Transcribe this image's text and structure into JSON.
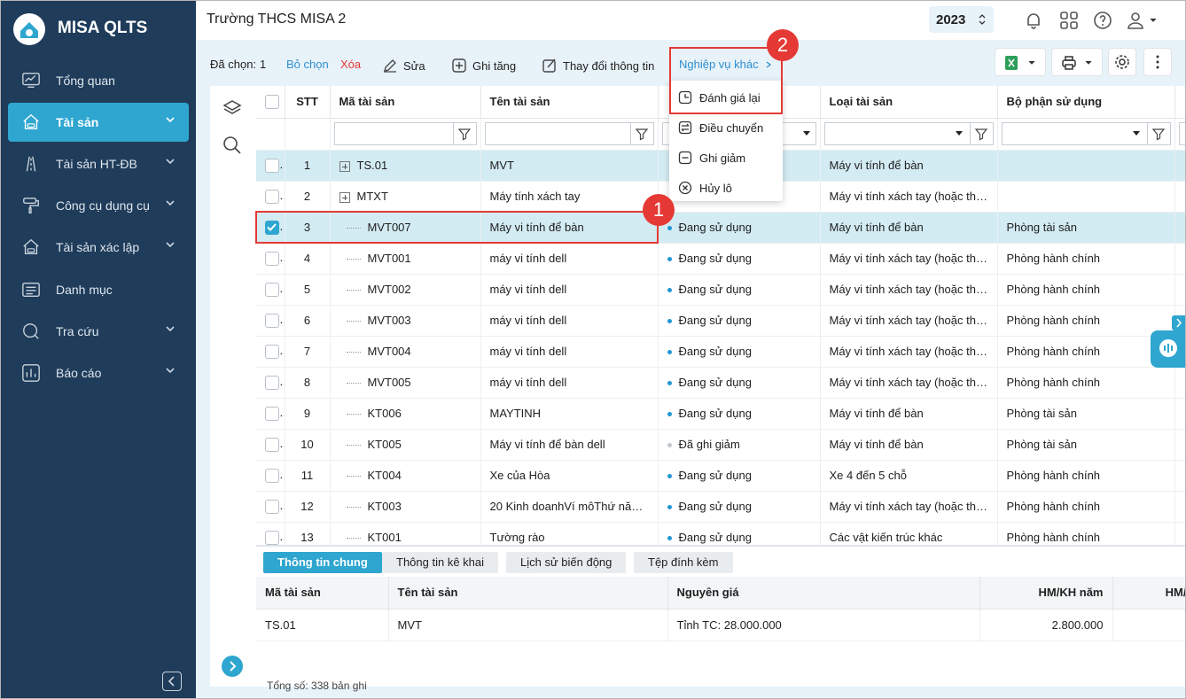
{
  "app": {
    "name": "MISA QLTS"
  },
  "sidebar": {
    "items": [
      {
        "label": "Tổng quan",
        "icon": "monitor-chart-icon"
      },
      {
        "label": "Tài sản",
        "icon": "house-car-icon",
        "active": true
      },
      {
        "label": "Tài sản HT-ĐB",
        "icon": "road-icon"
      },
      {
        "label": "Công cụ dụng cụ",
        "icon": "paint-roller-icon"
      },
      {
        "label": "Tài sản xác lập",
        "icon": "house-car-icon"
      },
      {
        "label": "Danh mục",
        "icon": "list-icon"
      },
      {
        "label": "Tra cứu",
        "icon": "search-icon"
      },
      {
        "label": "Báo cáo",
        "icon": "bar-chart-icon"
      }
    ]
  },
  "header": {
    "unit": "Trường THCS MISA 2",
    "year": "2023"
  },
  "toolbar": {
    "selected_label": "Đã chọn:",
    "selected_count": "1",
    "deselect": "Bỏ chọn",
    "delete": "Xóa",
    "edit": "Sửa",
    "increase": "Ghi tăng",
    "change_info": "Thay đổi thông tin",
    "other": "Nghiệp vụ khác"
  },
  "menu": {
    "items": [
      "Đánh giá lại",
      "Điều chuyển",
      "Ghi giảm",
      "Hủy lô"
    ]
  },
  "grid": {
    "columns": [
      "STT",
      "Mã tài sản",
      "Tên tài sản",
      "",
      "Loại tài sản",
      "Bộ phận sử dụng"
    ],
    "rows": [
      {
        "stt": "1",
        "code": "TS.01",
        "name": "MVT",
        "status": "",
        "type": "Máy vi tính để bàn",
        "dept": "",
        "parent": true,
        "hl": true
      },
      {
        "stt": "2",
        "code": "MTXT",
        "name": "Máy tính xách tay",
        "status": "",
        "type": "Máy vi tính xách tay (hoặc thiết…",
        "dept": "",
        "parent": true
      },
      {
        "stt": "3",
        "code": "MVT007",
        "name": "Máy vi tính để bàn",
        "status": "Đang sử dụng",
        "type": "Máy vi tính để bàn",
        "dept": "Phòng tài sản",
        "checked": true,
        "hl": true
      },
      {
        "stt": "4",
        "code": "MVT001",
        "name": "máy vi tính dell",
        "status": "Đang sử dụng",
        "type": "Máy vi tính xách tay (hoặc thiết…",
        "dept": "Phòng hành chính"
      },
      {
        "stt": "5",
        "code": "MVT002",
        "name": "máy vi tính dell",
        "status": "Đang sử dụng",
        "type": "Máy vi tính xách tay (hoặc thiết…",
        "dept": "Phòng hành chính"
      },
      {
        "stt": "6",
        "code": "MVT003",
        "name": "máy vi tính dell",
        "status": "Đang sử dụng",
        "type": "Máy vi tính xách tay (hoặc thiết…",
        "dept": "Phòng hành chính"
      },
      {
        "stt": "7",
        "code": "MVT004",
        "name": "máy vi tính dell",
        "status": "Đang sử dụng",
        "type": "Máy vi tính xách tay (hoặc thiết…",
        "dept": "Phòng hành chính"
      },
      {
        "stt": "8",
        "code": "MVT005",
        "name": "máy vi tính dell",
        "status": "Đang sử dụng",
        "type": "Máy vi tính xách tay (hoặc thiết…",
        "dept": "Phòng hành chính"
      },
      {
        "stt": "9",
        "code": "KT006",
        "name": "MAYTINH",
        "status": "Đang sử dụng",
        "type": "Máy vi tính để bàn",
        "dept": "Phòng tài sản"
      },
      {
        "stt": "10",
        "code": "KT005",
        "name": "Máy vi tính để bàn dell",
        "status": "Đã ghi giảm",
        "type": "Máy vi tính để bàn",
        "dept": "Phòng tài sản",
        "grey": true
      },
      {
        "stt": "11",
        "code": "KT004",
        "name": "Xe của Hòa",
        "status": "Đang sử dụng",
        "type": "Xe 4 đến 5 chỗ",
        "dept": "Phòng hành chính"
      },
      {
        "stt": "12",
        "code": "KT003",
        "name": "20 Kinh doanhVí môThứ năm, …",
        "status": "Đang sử dụng",
        "type": "Máy vi tính xách tay (hoặc thiết…",
        "dept": "Phòng hành chính"
      },
      {
        "stt": "13",
        "code": "KT001",
        "name": "Tường rào",
        "status": "Đang sử dụng",
        "type": "Các vật kiến trúc khác",
        "dept": "Phòng hành chính"
      }
    ]
  },
  "bottom": {
    "tabs": [
      "Thông tin chung",
      "Thông tin kê khai",
      "Lịch sử biến động",
      "Tệp đính kèm"
    ],
    "columns": [
      "Mã tài sản",
      "Tên tài sản",
      "Nguyên giá",
      "HM/KH năm",
      "HM/"
    ],
    "row": [
      "TS.01",
      "MVT",
      "Tỉnh TC: 28.000.000",
      "2.800.000",
      ""
    ],
    "footer": "Tổng số: 338 bản ghi"
  },
  "callouts": [
    "1",
    "2"
  ],
  "colors": {
    "sidebar": "#1f3c5a",
    "accent": "#2ea6cf",
    "callout": "#e53935"
  }
}
